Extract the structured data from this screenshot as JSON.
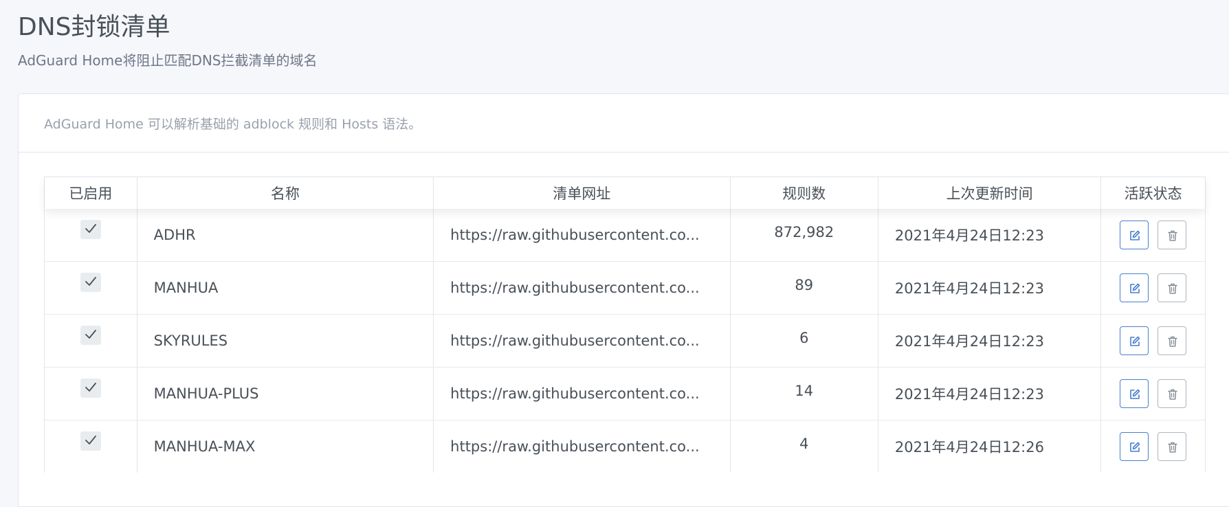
{
  "page": {
    "title": "DNS封锁清单",
    "subtitle": "AdGuard Home将阻止匹配DNS拦截清单的域名"
  },
  "card": {
    "description": "AdGuard Home 可以解析基础的 adblock 规则和 Hosts 语法。"
  },
  "table": {
    "headers": {
      "enabled": "已启用",
      "name": "名称",
      "url": "清单网址",
      "rules": "规则数",
      "updated": "上次更新时间",
      "status": "活跃状态"
    },
    "rows": [
      {
        "enabled": true,
        "name": "ADHR",
        "url": "https://raw.githubusercontent.co...",
        "rules": "872,982",
        "updated": "2021年4月24日12:23"
      },
      {
        "enabled": true,
        "name": "MANHUA",
        "url": "https://raw.githubusercontent.co...",
        "rules": "89",
        "updated": "2021年4月24日12:23"
      },
      {
        "enabled": true,
        "name": "SKYRULES",
        "url": "https://raw.githubusercontent.co...",
        "rules": "6",
        "updated": "2021年4月24日12:23"
      },
      {
        "enabled": true,
        "name": "MANHUA-PLUS",
        "url": "https://raw.githubusercontent.co...",
        "rules": "14",
        "updated": "2021年4月24日12:23"
      },
      {
        "enabled": true,
        "name": "MANHUA-MAX",
        "url": "https://raw.githubusercontent.co...",
        "rules": "4",
        "updated": "2021年4月24日12:26"
      }
    ]
  },
  "icons": {
    "check": "check-icon",
    "edit": "edit-icon",
    "delete": "trash-icon"
  },
  "colors": {
    "primary": "#467fcf",
    "muted": "#adb5bd",
    "text": "#495057"
  }
}
